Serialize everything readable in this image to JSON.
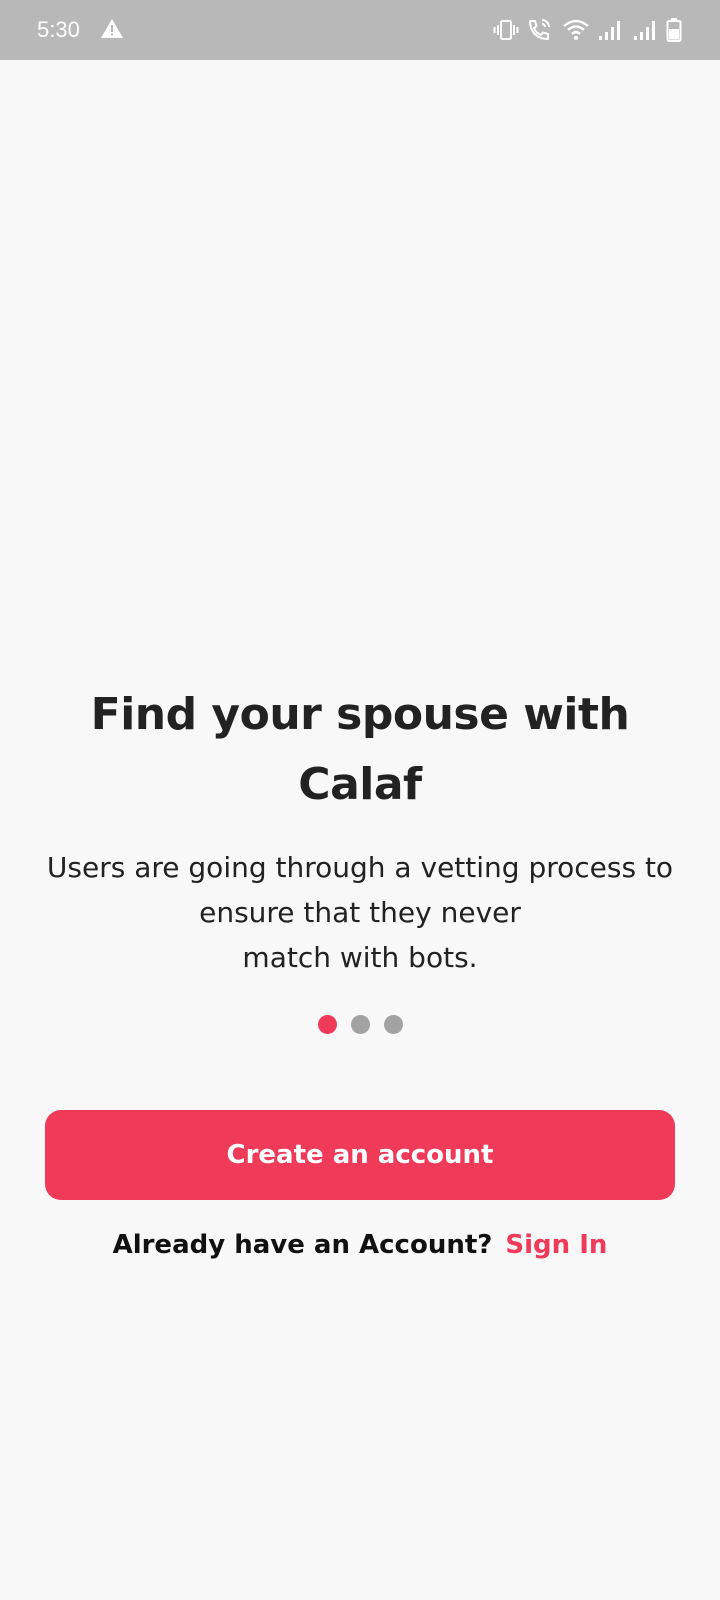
{
  "status_bar": {
    "time": "5:30",
    "icons": [
      "alert-icon",
      "vibrate-icon",
      "wifi-calling-icon",
      "wifi-icon",
      "signal-icon",
      "signal-icon",
      "battery-icon"
    ]
  },
  "onboarding": {
    "title": "Find your spouse with Calaf",
    "subtitle_line1": "Users are going through a vetting process to",
    "subtitle_line2": "ensure that they never",
    "subtitle_line3": "match with bots.",
    "page_indicator": {
      "total": 3,
      "active": 1
    },
    "create_button_label": "Create an account",
    "signin_prompt": "Already have an Account?",
    "signin_link": "Sign In"
  },
  "colors": {
    "accent": "#ef3a5a",
    "dot_inactive": "#a2a2a2",
    "background": "#f8f8f8",
    "status_bar": "#b8b8b8",
    "text": "#222222"
  }
}
